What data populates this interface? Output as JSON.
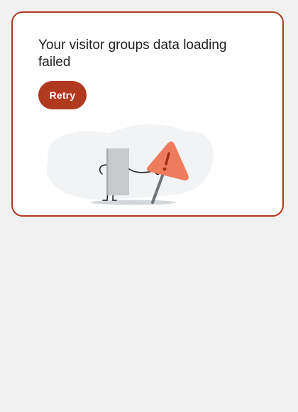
{
  "error_card": {
    "title": "Your visitor groups data loading failed",
    "retry_label": "Retry",
    "illustration_icon": "error-warning-sign-illustration"
  },
  "colors": {
    "accent": "#b0391f",
    "warning": "#ee7b5c",
    "page_background": "#f1f1f1",
    "card_background": "#ffffff"
  }
}
